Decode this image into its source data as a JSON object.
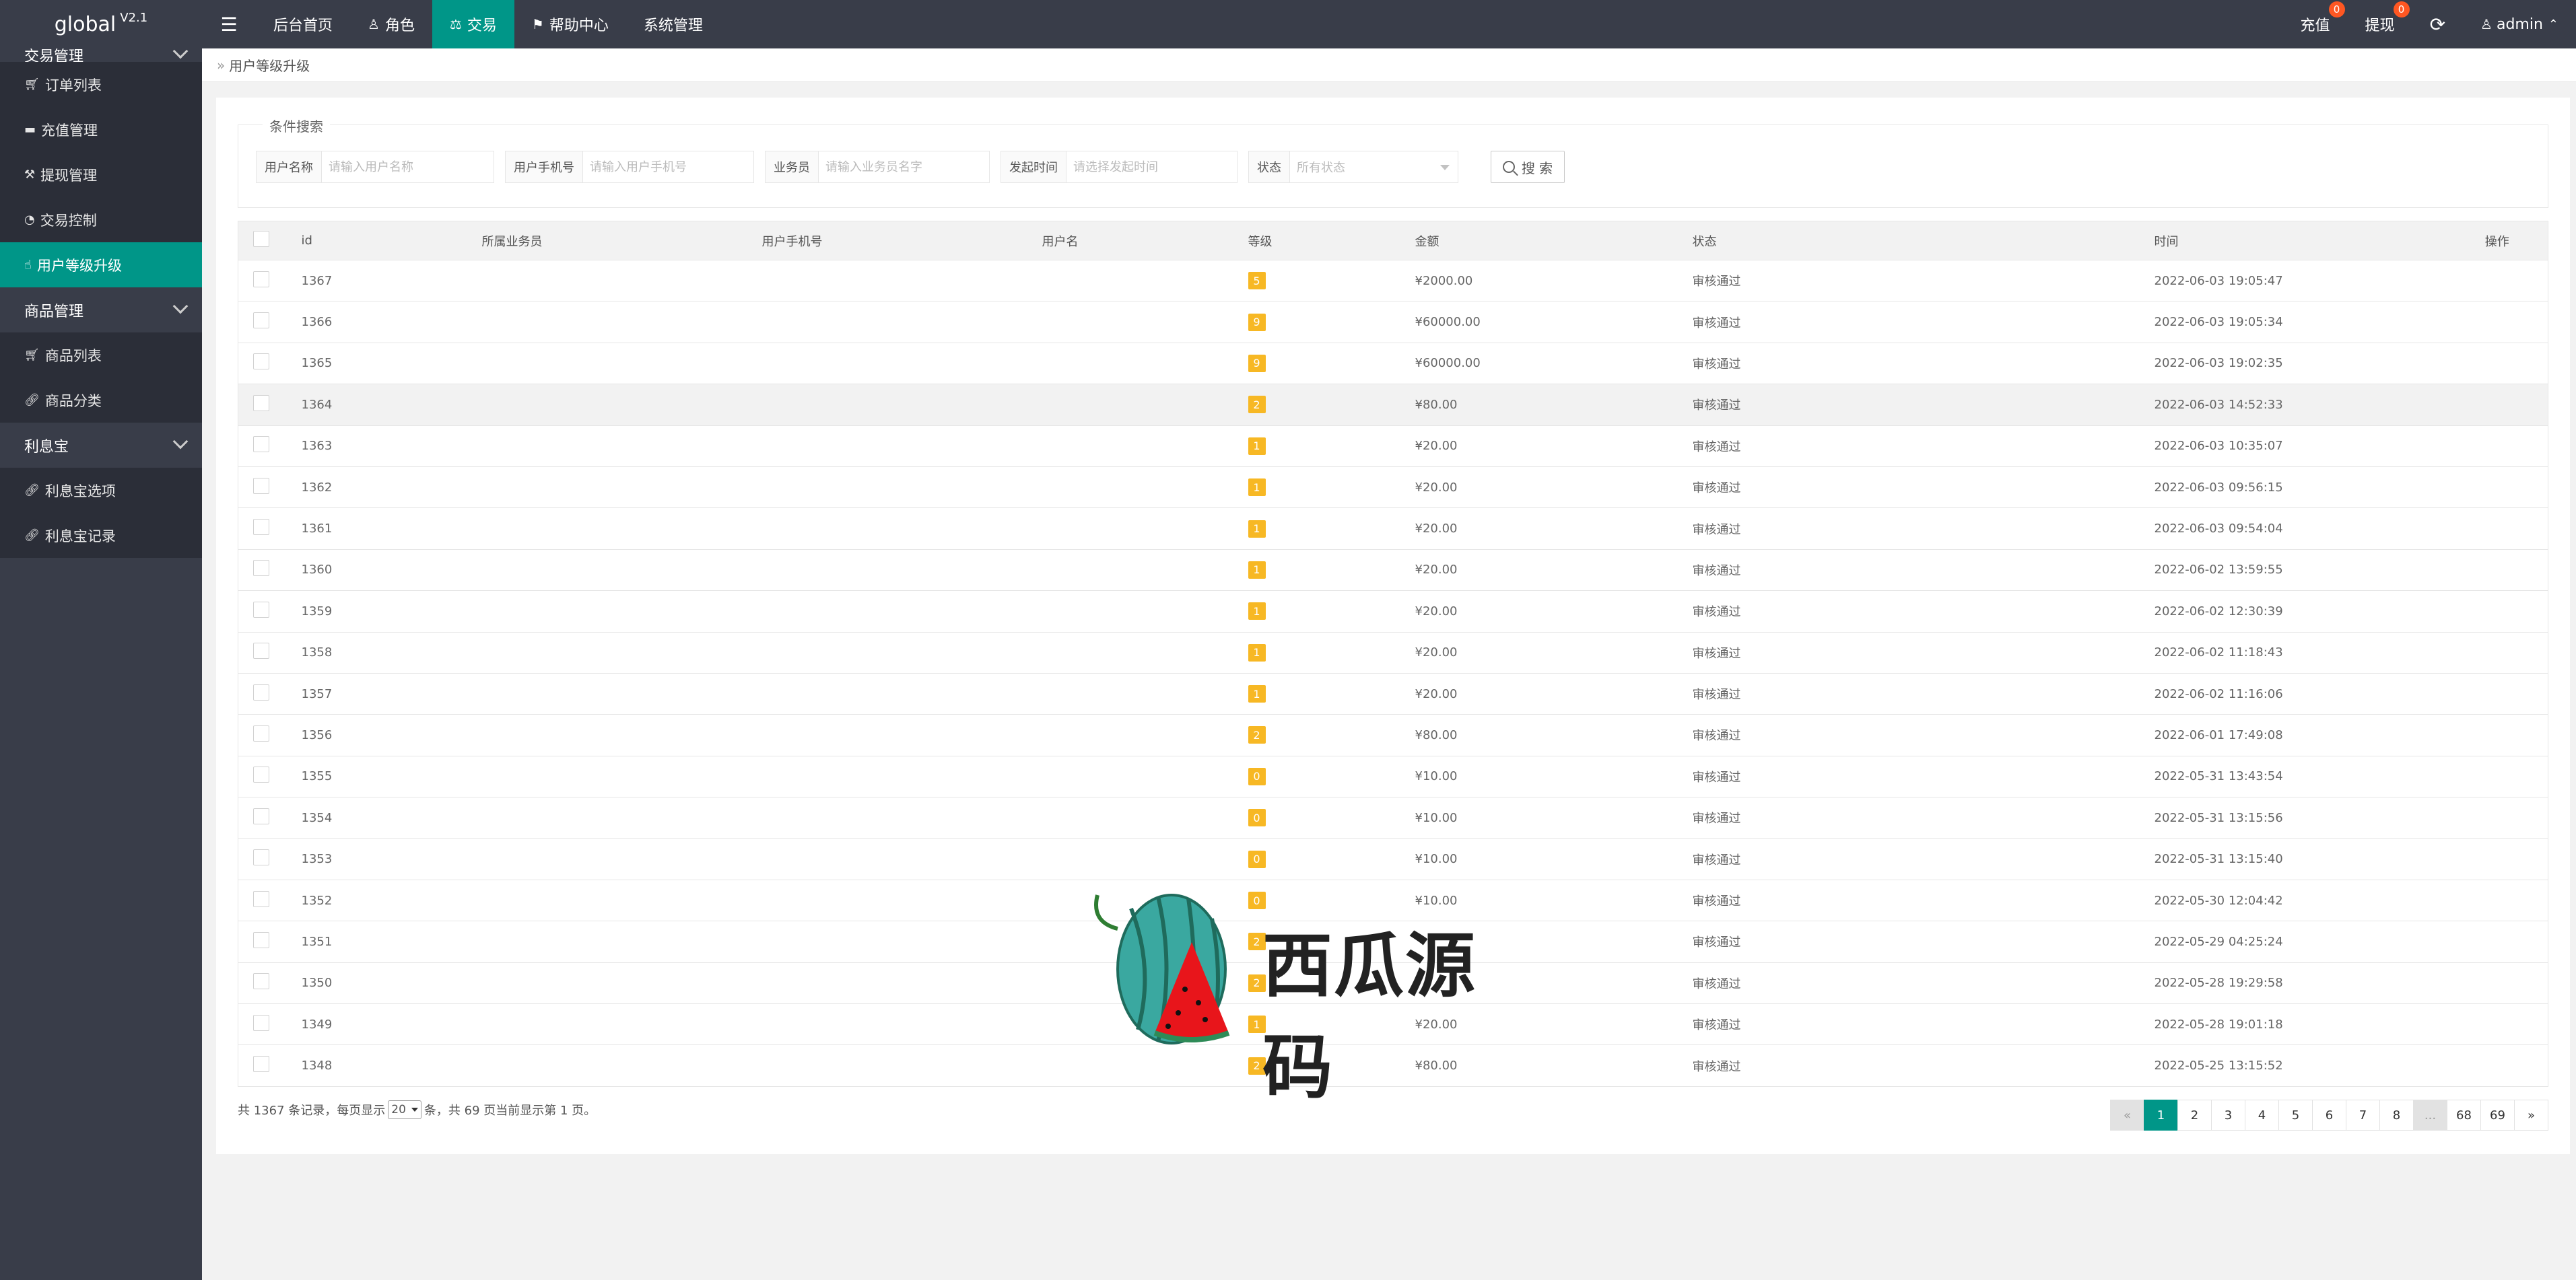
{
  "app": {
    "logo": "global",
    "version": "V2.1"
  },
  "topnav": {
    "menu_icon": "hamburger-icon",
    "items": [
      {
        "label": "后台首页",
        "icon": ""
      },
      {
        "label": "角色",
        "icon": "user-icon"
      },
      {
        "label": "交易",
        "icon": "scale-icon",
        "active": true
      },
      {
        "label": "帮助中心",
        "icon": "flag-icon"
      },
      {
        "label": "系统管理",
        "icon": ""
      }
    ]
  },
  "topright": {
    "recharge": {
      "label": "充值",
      "badge": "0"
    },
    "withdraw": {
      "label": "提现",
      "badge": "0"
    },
    "refresh_icon": "refresh-icon",
    "user": "admin"
  },
  "sidebar": {
    "group_trade": "交易管理",
    "trade_items": [
      {
        "label": "订单列表",
        "icon": "cart-icon"
      },
      {
        "label": "充值管理",
        "icon": "chat-icon"
      },
      {
        "label": "提现管理",
        "icon": "hammer-icon"
      },
      {
        "label": "交易控制",
        "icon": "gauge-icon"
      },
      {
        "label": "用户等级升级",
        "icon": "hand-icon",
        "active": true
      }
    ],
    "group_goods": "商品管理",
    "goods_items": [
      {
        "label": "商品列表",
        "icon": "cart-icon"
      },
      {
        "label": "商品分类",
        "icon": "link-icon"
      }
    ],
    "group_lixibao": "利息宝",
    "lixibao_items": [
      {
        "label": "利息宝选项",
        "icon": "link-icon"
      },
      {
        "label": "利息宝记录",
        "icon": "link-icon"
      }
    ]
  },
  "breadcrumb": "用户等级升级",
  "search": {
    "legend": "条件搜索",
    "username": {
      "label": "用户名称",
      "placeholder": "请输入用户名称"
    },
    "phone": {
      "label": "用户手机号",
      "placeholder": "请输入用户手机号"
    },
    "agent": {
      "label": "业务员",
      "placeholder": "请输入业务员名字"
    },
    "time": {
      "label": "发起时间",
      "placeholder": "请选择发起时间"
    },
    "status": {
      "label": "状态",
      "value": "所有状态"
    },
    "button": "搜 索"
  },
  "table": {
    "headers": [
      "id",
      "所属业务员",
      "用户手机号",
      "用户名",
      "等级",
      "金额",
      "状态",
      "时间",
      "操作"
    ],
    "rows": [
      {
        "id": "1367",
        "level": "5",
        "amount": "¥2000.00",
        "status": "审核通过",
        "time": "2022-06-03 19:05:47"
      },
      {
        "id": "1366",
        "level": "9",
        "amount": "¥60000.00",
        "status": "审核通过",
        "time": "2022-06-03 19:05:34"
      },
      {
        "id": "1365",
        "level": "9",
        "amount": "¥60000.00",
        "status": "审核通过",
        "time": "2022-06-03 19:02:35"
      },
      {
        "id": "1364",
        "level": "2",
        "amount": "¥80.00",
        "status": "审核通过",
        "time": "2022-06-03 14:52:33"
      },
      {
        "id": "1363",
        "level": "1",
        "amount": "¥20.00",
        "status": "审核通过",
        "time": "2022-06-03 10:35:07"
      },
      {
        "id": "1362",
        "level": "1",
        "amount": "¥20.00",
        "status": "审核通过",
        "time": "2022-06-03 09:56:15"
      },
      {
        "id": "1361",
        "level": "1",
        "amount": "¥20.00",
        "status": "审核通过",
        "time": "2022-06-03 09:54:04"
      },
      {
        "id": "1360",
        "level": "1",
        "amount": "¥20.00",
        "status": "审核通过",
        "time": "2022-06-02 13:59:55"
      },
      {
        "id": "1359",
        "level": "1",
        "amount": "¥20.00",
        "status": "审核通过",
        "time": "2022-06-02 12:30:39"
      },
      {
        "id": "1358",
        "level": "1",
        "amount": "¥20.00",
        "status": "审核通过",
        "time": "2022-06-02 11:18:43"
      },
      {
        "id": "1357",
        "level": "1",
        "amount": "¥20.00",
        "status": "审核通过",
        "time": "2022-06-02 11:16:06"
      },
      {
        "id": "1356",
        "level": "2",
        "amount": "¥80.00",
        "status": "审核通过",
        "time": "2022-06-01 17:49:08"
      },
      {
        "id": "1355",
        "level": "0",
        "amount": "¥10.00",
        "status": "审核通过",
        "time": "2022-05-31 13:43:54"
      },
      {
        "id": "1354",
        "level": "0",
        "amount": "¥10.00",
        "status": "审核通过",
        "time": "2022-05-31 13:15:56"
      },
      {
        "id": "1353",
        "level": "0",
        "amount": "¥10.00",
        "status": "审核通过",
        "time": "2022-05-31 13:15:40"
      },
      {
        "id": "1352",
        "level": "0",
        "amount": "¥10.00",
        "status": "审核通过",
        "time": "2022-05-30 12:04:42"
      },
      {
        "id": "1351",
        "level": "2",
        "amount": "",
        "status": "审核通过",
        "time": "2022-05-29 04:25:24"
      },
      {
        "id": "1350",
        "level": "2",
        "amount": "",
        "status": "审核通过",
        "time": "2022-05-28 19:29:58"
      },
      {
        "id": "1349",
        "level": "1",
        "amount": "¥20.00",
        "status": "审核通过",
        "time": "2022-05-28 19:01:18"
      },
      {
        "id": "1348",
        "level": "2",
        "amount": "¥80.00",
        "status": "审核通过",
        "time": "2022-05-25 13:15:52"
      }
    ]
  },
  "footer": {
    "prefix": "共 1367 条记录，每页显示",
    "per_page": "20",
    "suffix": "条，共 69 页当前显示第 1 页。"
  },
  "pagination": [
    "«",
    "1",
    "2",
    "3",
    "4",
    "5",
    "6",
    "7",
    "8",
    "...",
    "68",
    "69",
    "»"
  ],
  "watermark": "西瓜源码",
  "colors": {
    "accent": "#009688",
    "dark": "#393d49",
    "level_badge": "#f7b824",
    "badge": "#ff5722"
  }
}
